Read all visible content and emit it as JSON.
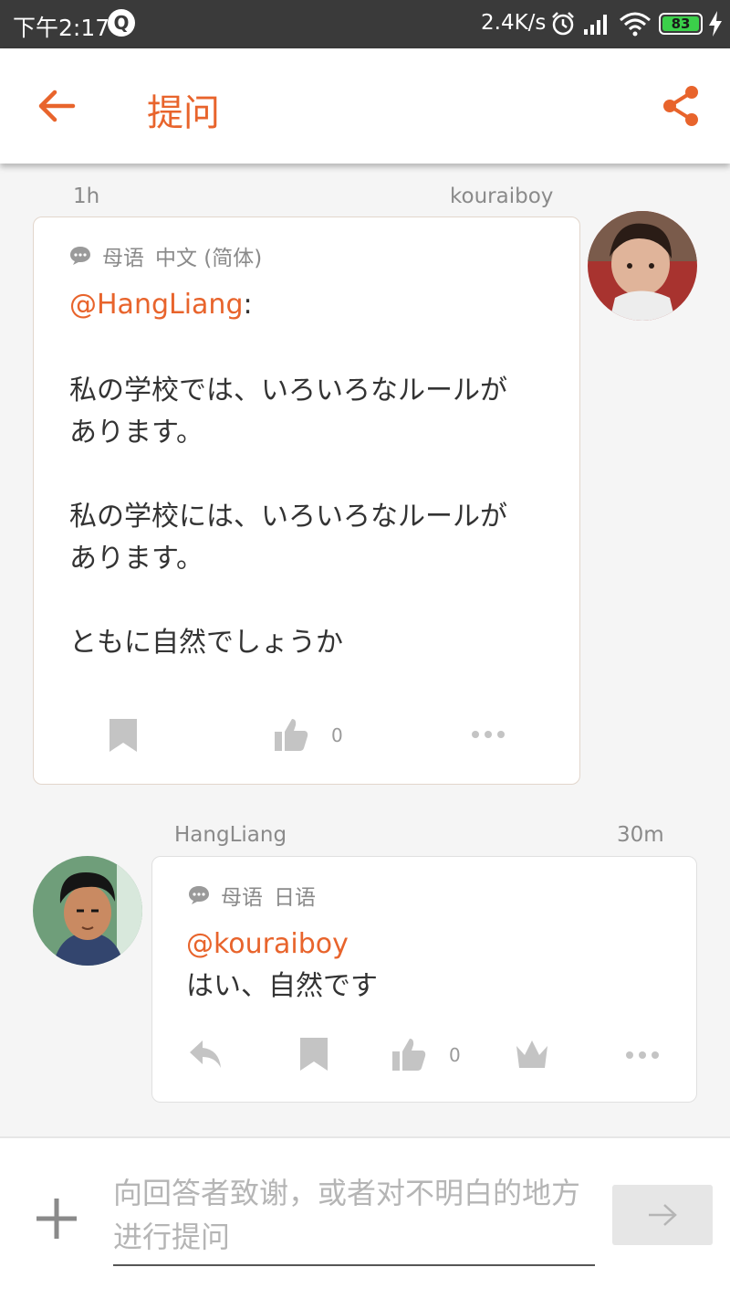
{
  "status_bar": {
    "time": "下午2:17",
    "network_speed": "2.4K/s",
    "battery_level": "83",
    "icons": [
      "q-icon",
      "alarm-icon",
      "signal-icon",
      "wifi-icon",
      "battery-icon",
      "charging-icon"
    ]
  },
  "app_bar": {
    "title": "提问",
    "accent_color": "#e8642c",
    "icons": [
      "back-arrow-icon",
      "share-icon"
    ]
  },
  "messages": [
    {
      "author": "kouraiboy",
      "time": "1h",
      "lang_label": "母语",
      "lang": "中文 (简体)",
      "mention": "@HangLiang",
      "mention_suffix": ":",
      "body": "私の学校では、いろいろなルールが\nあります。\n\n私の学校には、いろいろなルールが\nあります。\n\nともに自然でしょうか",
      "likes": "0",
      "actions": [
        "bookmark-icon",
        "thumbs-up-icon",
        "more-icon"
      ]
    },
    {
      "author": "HangLiang",
      "time": "30m",
      "lang_label": "母语",
      "lang": "日语",
      "mention": "@kouraiboy",
      "body": "はい、自然です",
      "likes": "0",
      "actions": [
        "reply-icon",
        "bookmark-icon",
        "thumbs-up-icon",
        "crown-icon",
        "more-icon"
      ]
    }
  ],
  "composer": {
    "placeholder": "向回答者致谢，或者对不明白的地方进行提问",
    "icons": [
      "plus-icon",
      "send-arrow-icon"
    ]
  }
}
